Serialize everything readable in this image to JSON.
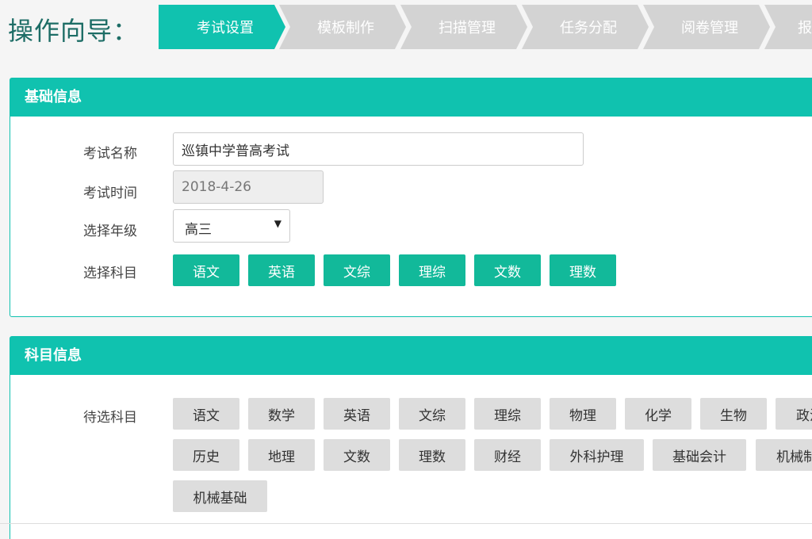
{
  "wizard": {
    "title": "操作向导：",
    "steps": [
      {
        "label": "考试设置",
        "active": true
      },
      {
        "label": "模板制作",
        "active": false
      },
      {
        "label": "扫描管理",
        "active": false
      },
      {
        "label": "任务分配",
        "active": false
      },
      {
        "label": "阅卷管理",
        "active": false
      },
      {
        "label": "报",
        "active": false
      }
    ]
  },
  "basic": {
    "header": "基础信息",
    "exam_name_label": "考试名称",
    "exam_name_value": "巡镇中学普高考试",
    "exam_time_label": "考试时间",
    "exam_time_value": "2018-4-26",
    "grade_label": "选择年级",
    "grade_value": "高三",
    "subject_label": "选择科目",
    "selected_subjects": [
      "语文",
      "英语",
      "文综",
      "理综",
      "文数",
      "理数"
    ]
  },
  "subject_info": {
    "header": "科目信息",
    "candidates_label": "待选科目",
    "candidates": [
      "语文",
      "数学",
      "英语",
      "文综",
      "理综",
      "物理",
      "化学",
      "生物",
      "政治",
      "历史",
      "地理",
      "文数",
      "理数",
      "财经",
      "外科护理",
      "基础会计",
      "机械制",
      "机械基础"
    ]
  },
  "colors": {
    "accent": "#10c2af",
    "chip_selected": "#12b99a",
    "chip_option": "#dddddd",
    "step_inactive": "#d3d3d3",
    "title": "#1d6d66"
  }
}
